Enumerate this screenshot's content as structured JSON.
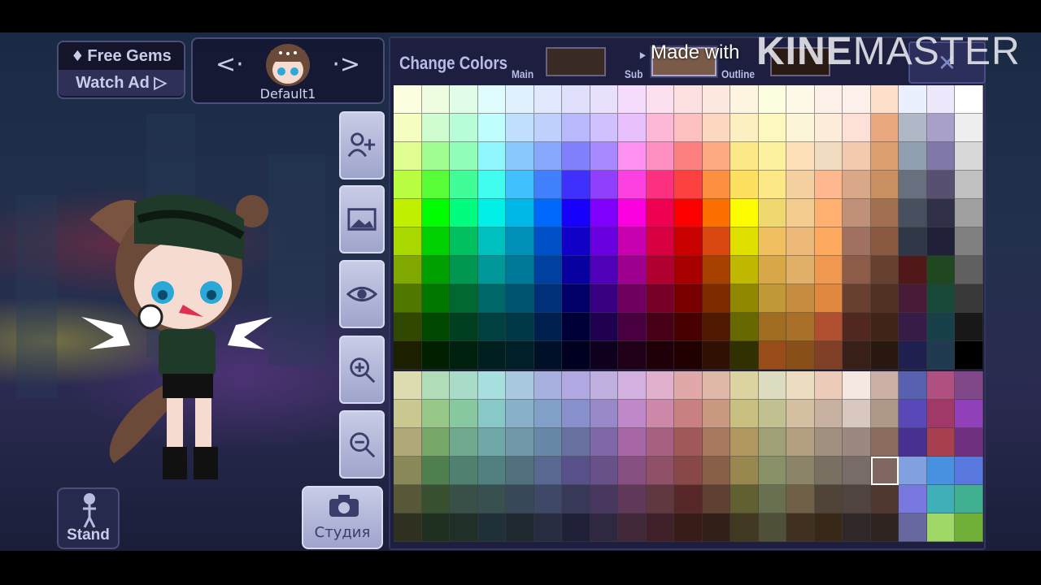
{
  "top_bar": {
    "free_gems": "Free Gems",
    "watch_ad": "Watch Ad ▷"
  },
  "preset": {
    "name": "Default1",
    "prev": "<·",
    "next": "·>"
  },
  "buttons": {
    "stand": "Stand",
    "studio": "Студия"
  },
  "side_icons": [
    "add-character-icon",
    "background-image-icon",
    "eye-icon",
    "zoom-in-icon",
    "zoom-out-icon"
  ],
  "color_panel": {
    "title": "Change Colors",
    "main_label": "Main",
    "sub_label": "Sub",
    "outline_label": "Outline",
    "close": "✕",
    "main_color": "#3a2a24",
    "sub_color": "#7a5a48",
    "outline_color": "#2a1a14",
    "selected_slot": "Sub",
    "selected_cell": {
      "section": "bottom",
      "row": 3,
      "col": 17
    },
    "palette_top": [
      [
        "#fdfde0",
        "#eefde0",
        "#e0fde8",
        "#e0fdfd",
        "#e0f0fd",
        "#e0e8fd",
        "#e0e0fd",
        "#e8e0fd",
        "#f5dcfd",
        "#fde0f0",
        "#fde0e0",
        "#fde8e0",
        "#fdf5e0",
        "#fdfde0",
        "#fdf8e8",
        "#fdf0e8",
        "#fdf0ea",
        "#fde0c8",
        "#eaf0fd",
        "#eee8fd",
        "#ffffff"
      ],
      [
        "#f5fdc0",
        "#d0fdd0",
        "#b8fdd8",
        "#c0fdfd",
        "#c0e0fd",
        "#c0d0fd",
        "#b8b8fd",
        "#d0c0fd",
        "#e8c0fd",
        "#fdb8d8",
        "#fdc0c0",
        "#fdd8c0",
        "#fdf0c0",
        "#fdf8c0",
        "#fdf5d8",
        "#fdecd8",
        "#fde0d8",
        "#eaa880",
        "#b0b8c8",
        "#a8a0c8",
        "#eeeeee"
      ],
      [
        "#e0fd90",
        "#a0fd90",
        "#90fdb8",
        "#90f8fd",
        "#88c8fd",
        "#88a8fd",
        "#8080fd",
        "#a888fd",
        "#fd90f0",
        "#fd90c0",
        "#fd8080",
        "#fdaa80",
        "#fde888",
        "#fdf0a0",
        "#fde0b8",
        "#f0dcc0",
        "#f5c8b0",
        "#dca070",
        "#90a0b0",
        "#8078a8",
        "#d8d8d8"
      ],
      [
        "#b8fd40",
        "#58fd38",
        "#40fd98",
        "#40fdf0",
        "#40c0fd",
        "#4080fd",
        "#4030fd",
        "#9040fd",
        "#fd40e0",
        "#fd3080",
        "#fd4040",
        "#fd9040",
        "#fde060",
        "#fde888",
        "#f5d0a0",
        "#fdb890",
        "#d8a888",
        "#c89060",
        "#687080",
        "#585070",
        "#c0c0c0"
      ],
      [
        "#c0f000",
        "#00fd00",
        "#00fd80",
        "#00f0e8",
        "#00b8e8",
        "#0068fd",
        "#1800fd",
        "#8000fd",
        "#fd00e0",
        "#f00050",
        "#fd0000",
        "#fd7000",
        "#fdfd00",
        "#f0d870",
        "#f5cc90",
        "#fdb070",
        "#c09078",
        "#a07050",
        "#485060",
        "#303048",
        "#a0a0a0"
      ],
      [
        "#a8d800",
        "#00d000",
        "#00c060",
        "#00c0c0",
        "#0090b8",
        "#0050c8",
        "#1000c8",
        "#6800e0",
        "#c800b0",
        "#d80040",
        "#c80000",
        "#d84810",
        "#e0e000",
        "#f0c060",
        "#ecb878",
        "#fdaa60",
        "#a07060",
        "#885840",
        "#303848",
        "#202038",
        "#808080"
      ],
      [
        "#80a800",
        "#00a000",
        "#009850",
        "#009898",
        "#007898",
        "#0040a0",
        "#0800a0",
        "#5000b8",
        "#a00090",
        "#b00030",
        "#a80000",
        "#a84000",
        "#c0b800",
        "#d8a848",
        "#e0b068",
        "#f09850",
        "#8c5c48",
        "#684030",
        "#501818",
        "#204820",
        "#606060"
      ],
      [
        "#507800",
        "#007800",
        "#006830",
        "#006868",
        "#005470",
        "#003078",
        "#000068",
        "#380080",
        "#700060",
        "#780028",
        "#780000",
        "#802c00",
        "#908800",
        "#c09838",
        "#c88c40",
        "#e08840",
        "#684030",
        "#503020",
        "#481c38",
        "#184838",
        "#383838"
      ],
      [
        "#304800",
        "#004800",
        "#004020",
        "#004040",
        "#003848",
        "#002050",
        "#000038",
        "#200050",
        "#480040",
        "#480018",
        "#480000",
        "#501800",
        "#686800",
        "#a06c20",
        "#a87028",
        "#b05030",
        "#502820",
        "#402418",
        "#381c48",
        "#184048",
        "#181818"
      ],
      [
        "#1c2000",
        "#002000",
        "#002010",
        "#002020",
        "#002028",
        "#001028",
        "#000020",
        "#100020",
        "#200018",
        "#200008",
        "#200000",
        "#301000",
        "#303000",
        "#984c18",
        "#885018",
        "#804028",
        "#382018",
        "#281810",
        "#202050",
        "#203a50",
        "#000000"
      ]
    ],
    "palette_bottom": [
      [
        "#dcdcb0",
        "#b0dcb8",
        "#a8dcc8",
        "#a8e0e0",
        "#a8c8e0",
        "#a8b0e0",
        "#b0a8e0",
        "#c0b0e0",
        "#d4b0e0",
        "#e0b0cc",
        "#e0a8a8",
        "#e0b8a8",
        "#dcd4a0",
        "#dcdcc0",
        "#ecdcc0",
        "#ecccb8",
        "#f5e8e0",
        "#ccb0a8",
        "#5860b0",
        "#b05080",
        "#804888"
      ],
      [
        "#c8c890",
        "#98c888",
        "#88c8a0",
        "#88c8c8",
        "#88b0c8",
        "#80a0c8",
        "#8890cc",
        "#9888c8",
        "#c088c8",
        "#cc88a8",
        "#c88080",
        "#c89880",
        "#c8c080",
        "#c0c090",
        "#d4c0a0",
        "#c8b0a0",
        "#d8c8c0",
        "#b09888",
        "#5848b8",
        "#a03868",
        "#9040b8"
      ],
      [
        "#b0a878",
        "#78a868",
        "#70a890",
        "#70a8a8",
        "#7098a8",
        "#6888a8",
        "#6870a0",
        "#8068a8",
        "#a868a8",
        "#a86080",
        "#a05858",
        "#a87860",
        "#b09860",
        "#a0a078",
        "#b4a080",
        "#a09080",
        "#9c8880",
        "#8c6c5c",
        "#483090",
        "#a84050",
        "#703080"
      ],
      [
        "#888858",
        "#508050",
        "#508070",
        "#508080",
        "#507080",
        "#586890",
        "#585088",
        "#685088",
        "#885080",
        "#905068",
        "#884848",
        "#886048",
        "#988850",
        "#889068",
        "#8c8468",
        "#787060",
        "#786c68",
        "#806860",
        "#80a0e0",
        "#4890e0",
        "#5878e0"
      ],
      [
        "#585838",
        "#385030",
        "#385048",
        "#385050",
        "#384858",
        "#404868",
        "#383858",
        "#483860",
        "#603858",
        "#603840",
        "#582828",
        "#604030",
        "#606030",
        "#687050",
        "#706048",
        "#504438",
        "#504440",
        "#503830",
        "#7878e0",
        "#40b0b8",
        "#40b090"
      ],
      [
        "#303020",
        "#203020",
        "#203028",
        "#203038",
        "#202830",
        "#282c40",
        "#202038",
        "#302840",
        "#402838",
        "#402028",
        "#381c18",
        "#302018",
        "#403820",
        "#505038",
        "#403020",
        "#382818",
        "#302828",
        "#302420",
        "#6868a0",
        "#a0d868",
        "#70b038"
      ]
    ]
  },
  "watermark": {
    "made_with": "Made with",
    "brand_bold": "KINE",
    "brand_light": "MASTER"
  }
}
